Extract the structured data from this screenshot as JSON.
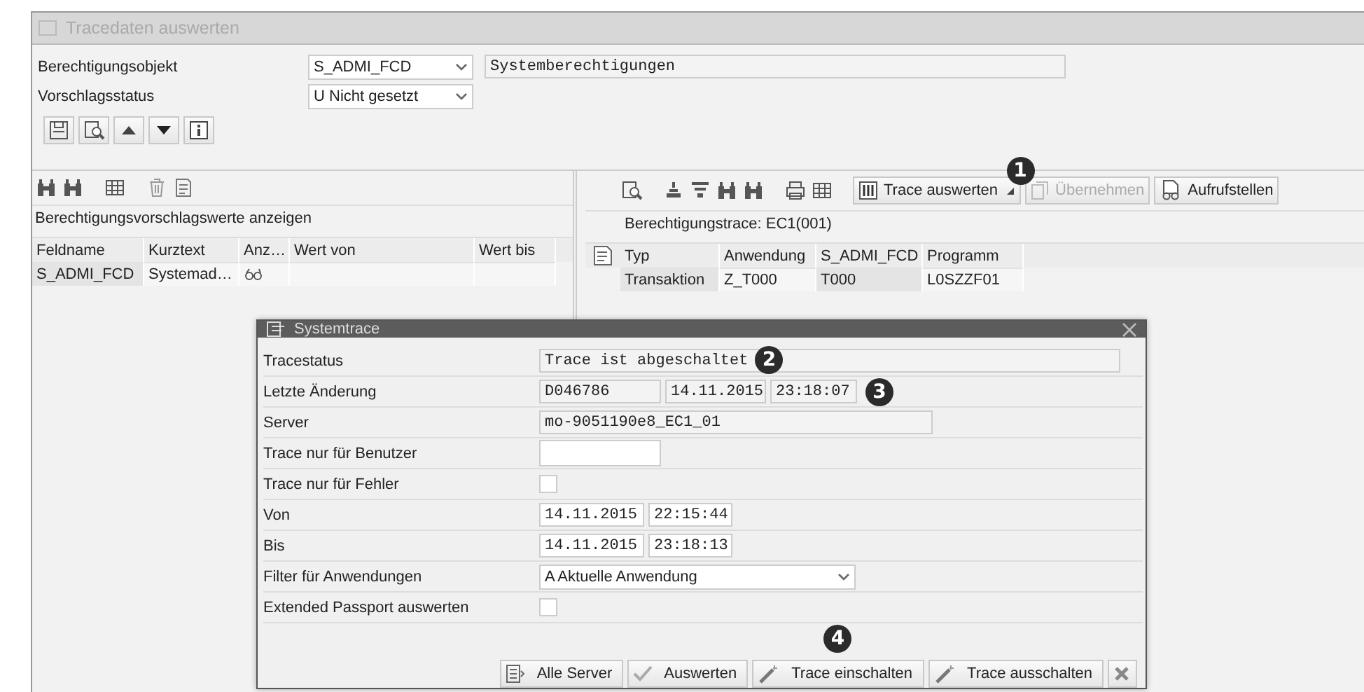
{
  "window": {
    "title": "Tracedaten auswerten"
  },
  "form": [
    {
      "label": "Berechtigungsobjekt",
      "value": "S_ADMI_FCD",
      "description": "Systemberechtigungen"
    },
    {
      "label": "Vorschlagsstatus",
      "value": "U Nicht gesetzt"
    }
  ],
  "left_pane": {
    "title": "Berechtigungsvorschlagswerte anzeigen",
    "table": {
      "columns": [
        "Feldname",
        "Kurztext",
        "Anz…",
        "Wert von",
        "Wert bis"
      ],
      "rows": [
        [
          "S_ADMI_FCD",
          "Systemad…",
          "",
          "",
          ""
        ]
      ]
    }
  },
  "right_pane": {
    "toolbar_buttons": [
      {
        "label": "Trace auswerten",
        "disabled": false
      },
      {
        "label": "Übernehmen",
        "disabled": true
      },
      {
        "label": "Aufrufstellen",
        "disabled": false
      }
    ],
    "title": "Berechtigungstrace: EC1(001)",
    "table": {
      "columns": [
        "Typ",
        "Anwendung",
        "S_ADMI_FCD",
        "Programm"
      ],
      "rows": [
        [
          "Transaktion",
          "Z_T000",
          "T000",
          "L0SZZF01"
        ]
      ]
    }
  },
  "dialog": {
    "title": "Systemtrace",
    "rows": [
      {
        "kind": "display",
        "label": "Tracestatus",
        "values": [
          "Trace ist abgeschaltet"
        ]
      },
      {
        "kind": "display",
        "label": "Letzte Änderung",
        "values": [
          "D046786",
          "14.11.2015",
          "23:18:07"
        ]
      },
      {
        "kind": "display",
        "label": "Server",
        "values": [
          "mo-9051190e8_EC1_01"
        ]
      },
      {
        "kind": "input",
        "label": "Trace nur für Benutzer",
        "values": []
      },
      {
        "kind": "checkbox",
        "label": "Trace nur für Fehler",
        "checked": false
      },
      {
        "kind": "input",
        "label": "Von",
        "values": [
          "14.11.2015",
          "22:15:44"
        ]
      },
      {
        "kind": "input",
        "label": "Bis",
        "values": [
          "14.11.2015",
          "23:18:13"
        ]
      },
      {
        "kind": "dropdown",
        "label": "Filter für Anwendungen",
        "values": [
          "A Aktuelle Anwendung"
        ]
      },
      {
        "kind": "checkbox",
        "label": "Extended Passport auswerten",
        "checked": false
      }
    ],
    "buttons": [
      "Alle Server",
      "Auswerten",
      "Trace einschalten",
      "Trace ausschalten"
    ]
  },
  "callouts": [
    "1",
    "2",
    "3",
    "4"
  ]
}
